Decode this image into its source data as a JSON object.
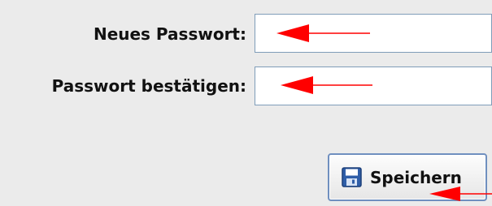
{
  "form": {
    "new_password_label": "Neues Passwort:",
    "confirm_password_label": "Passwort bestätigen:",
    "new_password_value": "",
    "confirm_password_value": ""
  },
  "actions": {
    "save_label": "Speichern",
    "save_icon": "floppy-disk-icon"
  },
  "annotations": {
    "arrow_color": "#ff0000"
  },
  "colors": {
    "panel_background": "#ebebeb",
    "field_border": "#7f9db9",
    "button_border": "#6f8fbf"
  }
}
